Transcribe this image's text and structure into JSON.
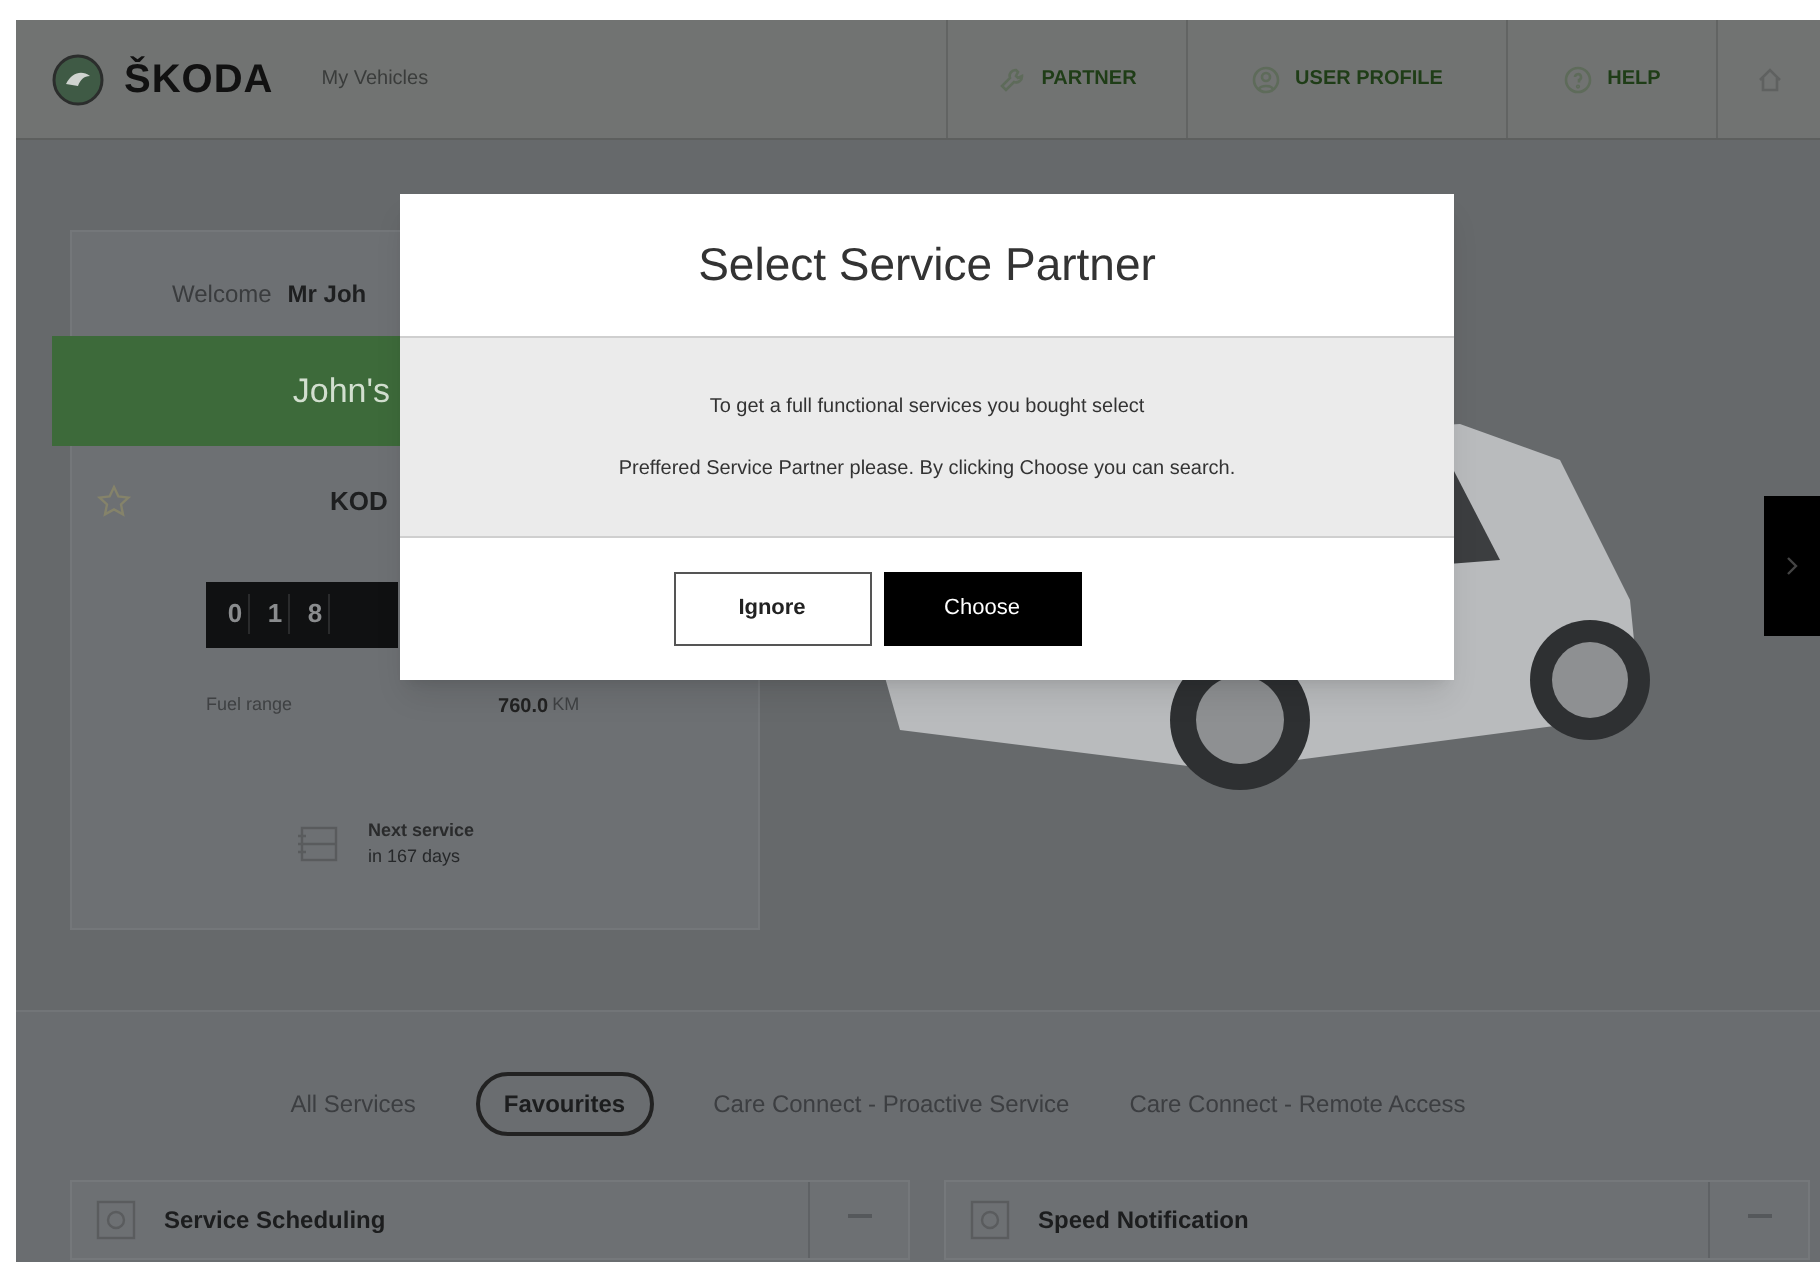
{
  "header": {
    "logo_text": "ŠKODA",
    "subtitle": "My Vehicles",
    "nav": [
      {
        "label": "PARTNER"
      },
      {
        "label": "USER PROFILE"
      },
      {
        "label": "HELP"
      }
    ]
  },
  "vehicle_card": {
    "welcome_label": "Welcome",
    "user_name": "Mr Joh",
    "vehicle_name": "John's",
    "model": "KOD",
    "odometer_digits": [
      "0",
      "1",
      "8"
    ],
    "fuel_range_label": "Fuel range",
    "fuel_range_value": "760.0",
    "fuel_range_unit": "KM",
    "next_service_label": "Next service",
    "next_service_value": "in 167 days"
  },
  "dialog": {
    "title": "Select Service Partner",
    "message_lines": [
      "To get a full functional services you bought select",
      "Preffered Service Partner please. By clicking Choose you can search."
    ],
    "buttons": [
      {
        "label": "Ignore",
        "kind": "secondary"
      },
      {
        "label": "Choose",
        "kind": "primary"
      }
    ]
  },
  "service_tabs": [
    {
      "label": "All Services",
      "selected": false
    },
    {
      "label": "Favourites",
      "selected": true
    },
    {
      "label": "Care Connect - Proactive Service",
      "selected": false
    },
    {
      "label": "Care Connect - Remote Access",
      "selected": false
    }
  ],
  "services": [
    {
      "name": "Service Scheduling"
    },
    {
      "name": "Speed Notification"
    }
  ]
}
